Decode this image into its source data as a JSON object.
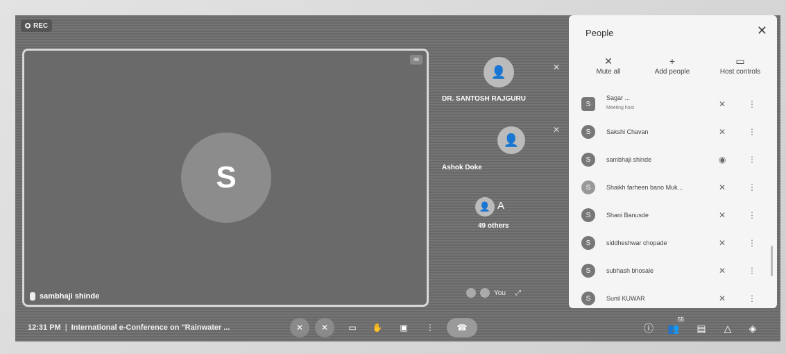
{
  "recording": {
    "label": "REC"
  },
  "main_tile": {
    "avatar_letter": "S",
    "name": "sambhaji shinde",
    "corner_badge": "48"
  },
  "side_tiles": [
    {
      "name": "DR. SANTOSH RAJGURU"
    },
    {
      "name": "Ashok Doke"
    },
    {
      "avatar_letter": "A",
      "label": "49 others"
    }
  ],
  "self_view": {
    "label": "You"
  },
  "bottom_bar": {
    "time": "12:31 PM",
    "separator": "|",
    "meeting_title": "International e-Conference on \"Rainwater ..."
  },
  "people_panel": {
    "title": "People",
    "actions": [
      "Mute all",
      "Add people",
      "Host controls"
    ],
    "participants": [
      {
        "name": "Sagar ...",
        "subtitle": "Meeting host",
        "avatar": "S"
      },
      {
        "name": "Sakshi Chavan",
        "avatar": "S"
      },
      {
        "name": "sambhaji shinde",
        "avatar": "S"
      },
      {
        "name": "Shaikh farheen bano Muk...",
        "avatar": "S"
      },
      {
        "name": "Shani Banusde",
        "avatar": "S"
      },
      {
        "name": "siddheshwar chopade",
        "avatar": "S"
      },
      {
        "name": "subhash bhosale",
        "avatar": "S"
      },
      {
        "name": "Sunil KUWAR",
        "avatar": "S"
      }
    ]
  },
  "right_controls_badge": "55"
}
